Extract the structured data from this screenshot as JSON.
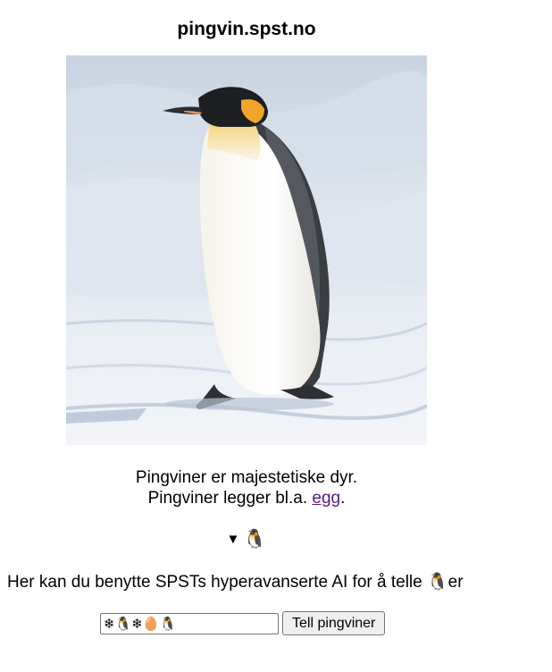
{
  "page": {
    "title": "pingvin.spst.no"
  },
  "photo": {
    "alt": "Emperor penguin standing on snow",
    "icon": "penguin-photo"
  },
  "description": {
    "line1": "Pingviner er majestetiske dyr.",
    "line2_prefix": "Pingviner legger bl.a. ",
    "egg_link": "egg",
    "line2_suffix": "."
  },
  "details": {
    "marker": "▼",
    "summary": "🐧",
    "icon": "disclosure-triangle-icon"
  },
  "counter": {
    "intro_prefix": "Her kan du benytte SPSTs hyperavanserte AI for å telle ",
    "intro_emoji": "🐧",
    "intro_suffix": "er",
    "input_value": "❄🐧❄🥚🐧",
    "button_label": "Tell pingviner"
  }
}
